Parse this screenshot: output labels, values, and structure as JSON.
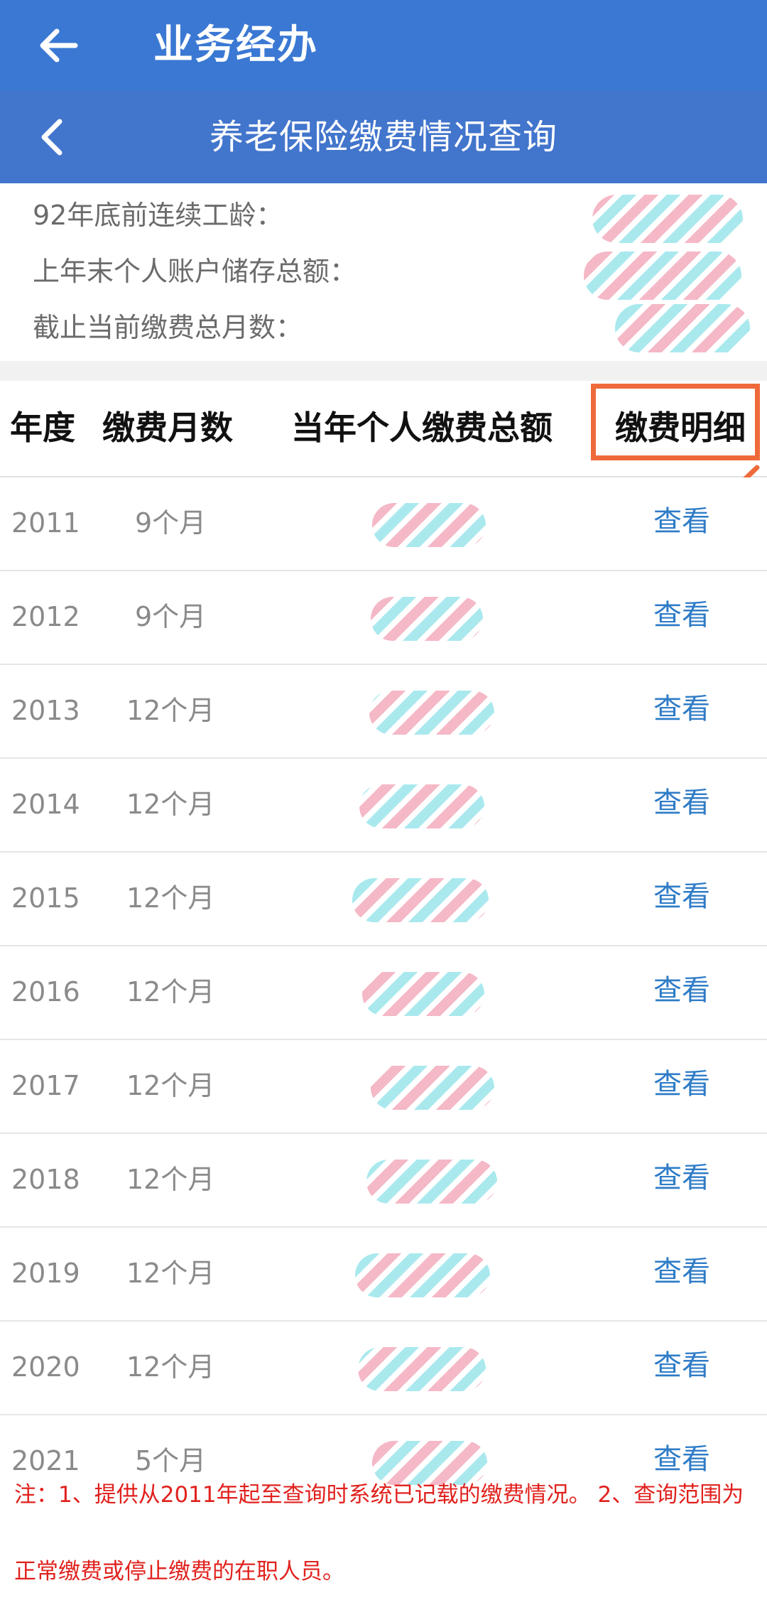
{
  "app_bar": {
    "title": "业务经办"
  },
  "sub_bar": {
    "title": "养老保险缴费情况查询"
  },
  "summary": {
    "items": [
      {
        "label": "92年底前连续工龄："
      },
      {
        "label": "上年末个人账户储存总额："
      },
      {
        "label": "截止当前缴费总月数："
      }
    ]
  },
  "table": {
    "headers": [
      "年度",
      "缴费月数",
      "当年个人缴费总额",
      "缴费明细"
    ],
    "rows": [
      {
        "year": "2011",
        "months": "9个月",
        "action": "查看"
      },
      {
        "year": "2012",
        "months": "9个月",
        "action": "查看"
      },
      {
        "year": "2013",
        "months": "12个月",
        "action": "查看"
      },
      {
        "year": "2014",
        "months": "12个月",
        "action": "查看"
      },
      {
        "year": "2015",
        "months": "12个月",
        "action": "查看"
      },
      {
        "year": "2016",
        "months": "12个月",
        "action": "查看"
      },
      {
        "year": "2017",
        "months": "12个月",
        "action": "查看"
      },
      {
        "year": "2018",
        "months": "12个月",
        "action": "查看"
      },
      {
        "year": "2019",
        "months": "12个月",
        "action": "查看"
      },
      {
        "year": "2020",
        "months": "12个月",
        "action": "查看"
      },
      {
        "year": "2021",
        "months": "5个月",
        "action": "查看"
      }
    ]
  },
  "note": "注：1、提供从2011年起至查询时系统已记载的缴费情况。 2、查询范围为正常缴费或停止缴费的在职人员。",
  "colors": {
    "app_bar": "#3a78d3",
    "sub_bar": "#4275cc",
    "link": "#2f7cc7",
    "highlight": "#ef6a3a",
    "note": "#e0211d"
  }
}
